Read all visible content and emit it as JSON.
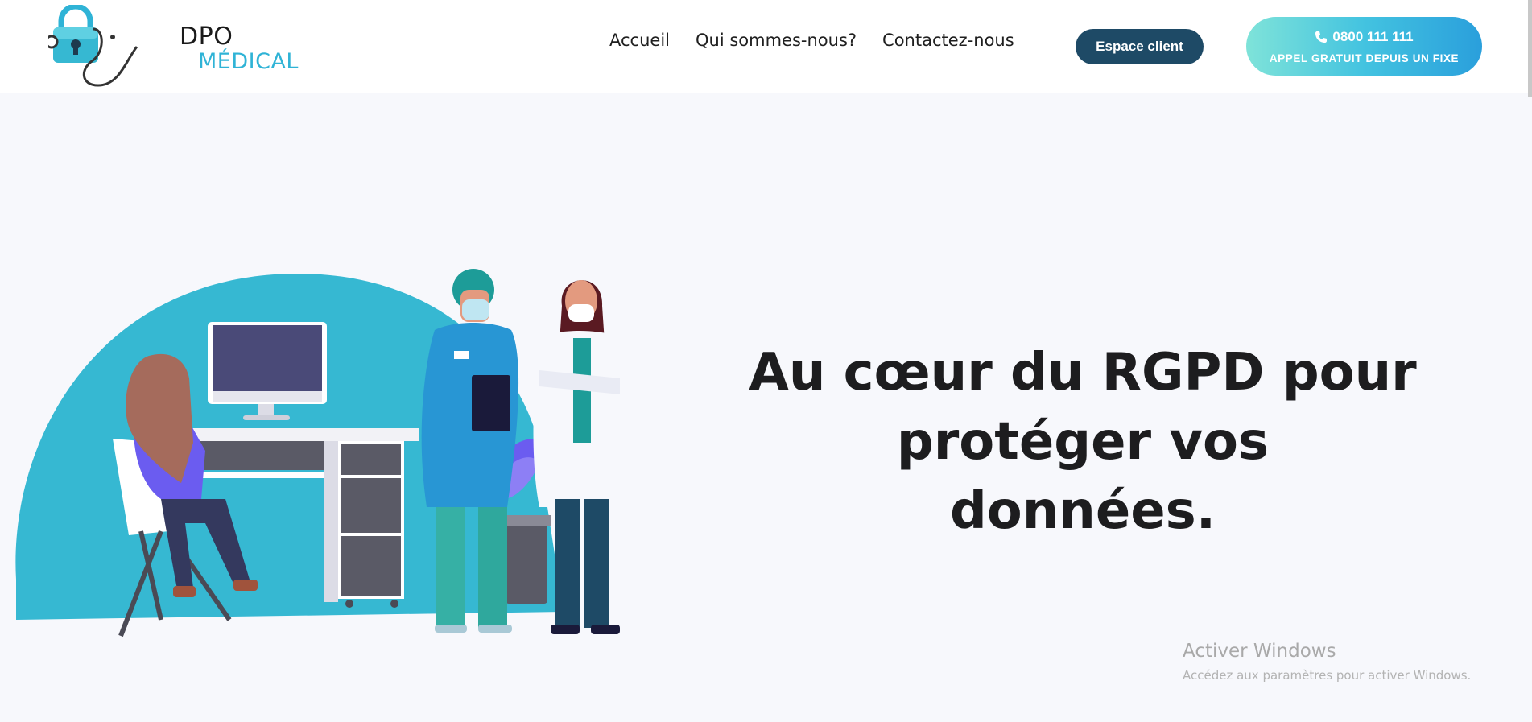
{
  "brand": {
    "logo_top": "DPO",
    "logo_bottom": "MÉDICAL",
    "logo_icon": "padlock-stethoscope-icon"
  },
  "nav": {
    "items": [
      "Accueil",
      "Qui sommes-nous?",
      "Contactez-nous"
    ]
  },
  "header": {
    "client_button": "Espace client",
    "phone_icon": "phone-icon",
    "phone_number": "0800 111 111",
    "phone_note": "APPEL GRATUIT DEPUIS UN FIXE"
  },
  "hero": {
    "title_line1": "Au cœur du RGPD pour",
    "title_line2": "protéger vos",
    "title_line3": "données.",
    "illustration": "medical-staff-office-illustration"
  },
  "os_overlay": {
    "title": "Activer Windows",
    "subtitle": "Accédez aux paramètres pour activer Windows."
  },
  "colors": {
    "accent": "#36b8d2",
    "client_button": "#1e4a66",
    "phone_gradient_start": "#7fe3d9",
    "phone_gradient_end": "#2a9fdc",
    "title": "#1d1d1f"
  }
}
